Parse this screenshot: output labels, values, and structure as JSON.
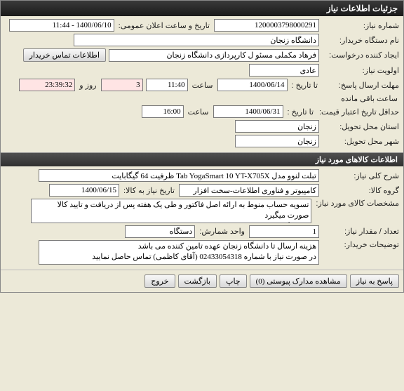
{
  "window": {
    "title": "جزئیات اطلاعات نیاز"
  },
  "general": {
    "need_no_lbl": "شماره نیاز:",
    "need_no": "1200003798000291",
    "announce_lbl": "تاریخ و ساعت اعلان عمومی:",
    "announce_val": "1400/06/10 - 11:44",
    "buyer_lbl": "نام دستگاه خریدار:",
    "buyer_val": "دانشگاه زنجان",
    "creator_lbl": "ایجاد کننده درخواست:",
    "creator_val": "فرهاد مکملی مسئو ل کارپردازی دانشگاه زنجان",
    "contact_btn": "اطلاعات تماس خریدار",
    "priority_lbl": "اولویت نیاز:",
    "priority_val": "عادی",
    "deadline_lbl": "مهلت ارسال پاسخ:",
    "until_lbl": "تا تاریخ :",
    "deadline_date": "1400/06/14",
    "time_lbl": "ساعت",
    "deadline_time": "11:40",
    "remain_days": "3",
    "remain_days_lbl": "روز و",
    "remain_time": "23:39:32",
    "remain_suffix": "ساعت باقی مانده",
    "price_valid_lbl": "حداقل تاریخ اعتبار قیمت:",
    "price_valid_date": "1400/06/31",
    "price_valid_time": "16:00",
    "province_lbl": "استان محل تحویل:",
    "province_val": "زنجان",
    "city_lbl": "شهر محل تحویل:",
    "city_val": "زنجان"
  },
  "items_section": {
    "header": "اطلاعات کالاهای مورد نیاز",
    "desc_lbl": "شرح کلی نیاز:",
    "desc_val": "تبلت لنوو مدل Tab YogaSmart 10 YT-X705X ظرفیت 64 گیگابایت",
    "group_lbl": "گروه کالا:",
    "group_val": "کامپیوتر و فناوری اطلاعات-سخت افزار",
    "need_date_lbl": "تاریخ نیاز به کالا:",
    "need_date_val": "1400/06/15",
    "spec_lbl": "مشخصات کالای مورد نیاز:",
    "spec_val": "تسویه حساب منوط به ارائه اصل فاکتور و طی یک هفته پس از دریافت و تایید کالا صورت میگیرد\nدارای گارانتی معتبر و طرح ریجستری مجاز باشد.",
    "qty_lbl": "تعداد / مقدار نیاز:",
    "qty_val": "1",
    "unit_lbl": "واحد شمارش:",
    "unit_val": "دستگاه",
    "buyer_note_lbl": "توضیحات خریدار:",
    "buyer_note_val": "هزینه ارسال تا دانشگاه زنجان عهده تامین کننده می باشد\nدر صورت نیاز با شماره 02433054318 (آقای کاظمی) تماس حاصل نمایید"
  },
  "footer": {
    "reply": "پاسخ به نیاز",
    "attach": "مشاهده مدارک پیوستی (0)",
    "print": "چاپ",
    "back": "بازگشت",
    "exit": "خروج"
  }
}
